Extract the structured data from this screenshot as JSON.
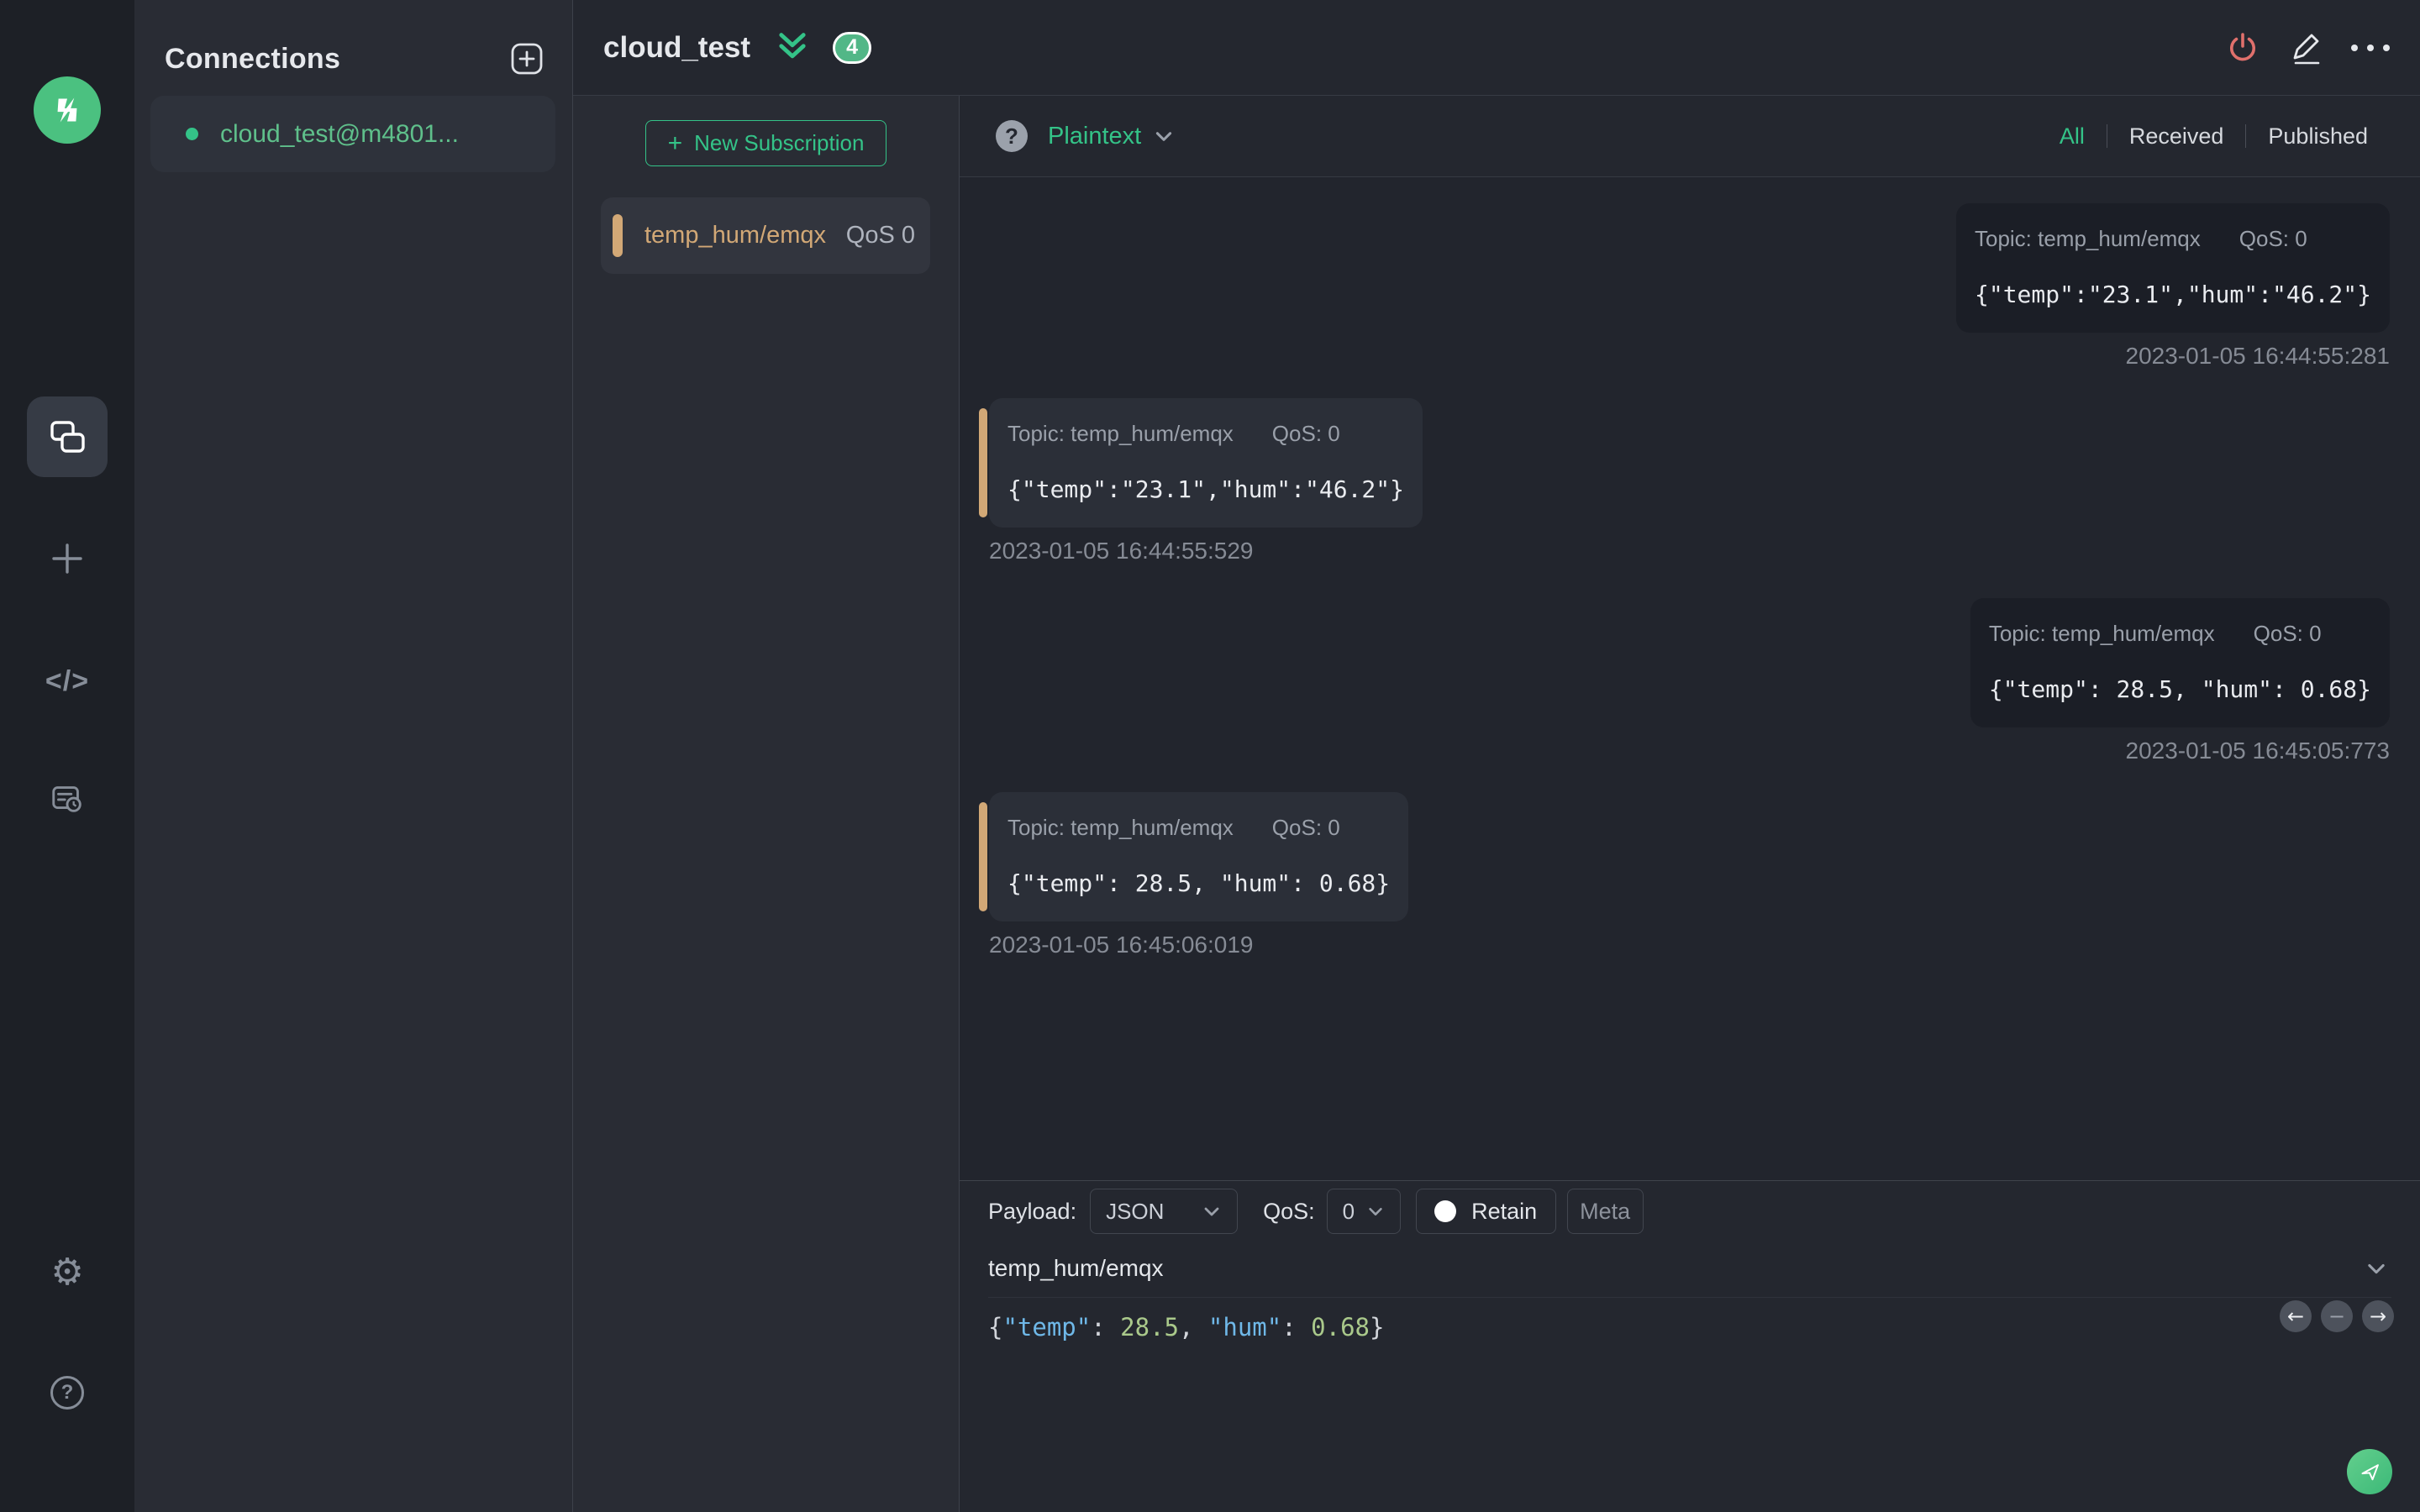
{
  "colors": {
    "accent_green": "#34c388",
    "topic_tan": "#d2a876",
    "power_red": "#e0706c",
    "badge_green": "#52b787",
    "syntax_key_blue": "#6fb8e8",
    "syntax_number_green": "#aac98b"
  },
  "rail": {
    "icons": [
      "mqttx-logo",
      "connections-icon",
      "new-connection-plus-icon",
      "script-icon",
      "log-icon",
      "settings-gear-icon",
      "help-icon"
    ],
    "code_icon_glyph": "</>",
    "gear_glyph": "⚙",
    "help_glyph": "?"
  },
  "connections_panel": {
    "title": "Connections",
    "items": [
      {
        "name": "cloud_test@m4801...",
        "status": "connected"
      }
    ]
  },
  "header": {
    "title": "cloud_test",
    "unread_badge": "4"
  },
  "subscriptions": {
    "new_button_label": "New Subscription",
    "new_button_plus": "+",
    "items": [
      {
        "topic": "temp_hum/emqx",
        "qos": "QoS 0"
      }
    ]
  },
  "messages": {
    "toolbar": {
      "help_glyph": "?",
      "format_selected": "Plaintext",
      "filters": {
        "all": "All",
        "received": "Received",
        "published": "Published"
      },
      "active_filter": "All"
    },
    "items": [
      {
        "side": "published",
        "topic_label": "Topic: temp_hum/emqx",
        "qos_label": "QoS: 0",
        "payload": "{\"temp\":\"23.1\",\"hum\":\"46.2\"}",
        "timestamp": "2023-01-05 16:44:55:281"
      },
      {
        "side": "received",
        "topic_label": "Topic: temp_hum/emqx",
        "qos_label": "QoS: 0",
        "payload": "{\"temp\":\"23.1\",\"hum\":\"46.2\"}",
        "timestamp": "2023-01-05 16:44:55:529"
      },
      {
        "side": "published",
        "topic_label": "Topic: temp_hum/emqx",
        "qos_label": "QoS: 0",
        "payload": "{\"temp\": 28.5, \"hum\": 0.68}",
        "timestamp": "2023-01-05 16:45:05:773"
      },
      {
        "side": "received",
        "topic_label": "Topic: temp_hum/emqx",
        "qos_label": "QoS: 0",
        "payload": "{\"temp\": 28.5, \"hum\": 0.68}",
        "timestamp": "2023-01-05 16:45:06:019"
      }
    ]
  },
  "publish": {
    "payload_label": "Payload:",
    "payload_format_value": "JSON",
    "qos_label": "QoS:",
    "qos_value": "0",
    "retain_label": "Retain",
    "meta_label": "Meta",
    "topic_value": "temp_hum/emqx",
    "history_nav": {
      "prev": "←",
      "dash": "−",
      "next": "→"
    },
    "editor_tokens": [
      "{",
      "\"temp\"",
      ": ",
      "28.5",
      ", ",
      "\"hum\"",
      ": ",
      "0.68",
      "}"
    ]
  }
}
